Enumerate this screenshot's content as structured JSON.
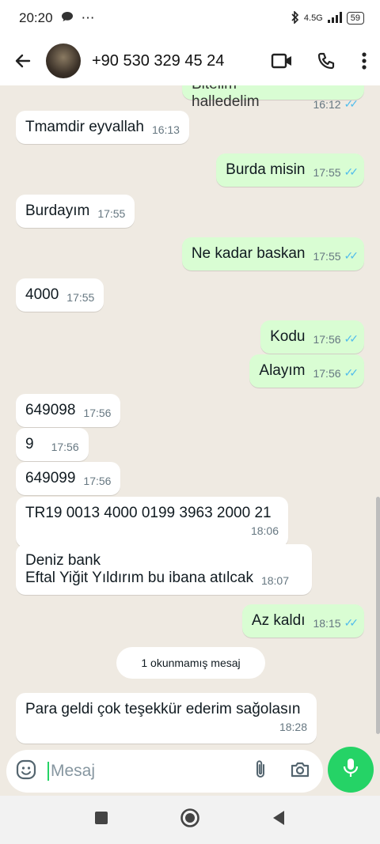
{
  "status_bar": {
    "time": "20:20",
    "network": "4.5G",
    "battery": "59"
  },
  "header": {
    "contact": "+90 530 329 45 24"
  },
  "messages": [
    {
      "text": "Bitelim halledelim",
      "time": "16:12"
    },
    {
      "text": "Tmamdir eyvallah",
      "time": "16:13"
    },
    {
      "text": "Burda misin",
      "time": "17:55"
    },
    {
      "text": "Burdayım",
      "time": "17:55"
    },
    {
      "text": "Ne kadar baskan",
      "time": "17:55"
    },
    {
      "text": "4000",
      "time": "17:55"
    },
    {
      "text": "Kodu",
      "time": "17:56"
    },
    {
      "text": "Alayım",
      "time": "17:56"
    },
    {
      "text": "649098",
      "time": "17:56"
    },
    {
      "text": "9",
      "time": "17:56"
    },
    {
      "text": "649099",
      "time": "17:56"
    },
    {
      "text": "TR19 0013 4000 0199 3963 2000 21",
      "time": "18:06"
    },
    {
      "line1": "Deniz bank",
      "line2": "Eftal Yiğit Yıldırım bu ibana atılcak",
      "time": "18:07"
    },
    {
      "text": "Az kaldı",
      "time": "18:15"
    },
    {
      "text": "Para geldi çok teşekkür ederim sağolasın",
      "time": "18:28"
    }
  ],
  "unread_banner": "1 okunmamış mesaj",
  "input": {
    "placeholder": "Mesaj"
  },
  "colors": {
    "outgoing": "#d9fdd3",
    "incoming": "#ffffff",
    "accent": "#25d366",
    "read_ticks": "#53bdeb"
  }
}
